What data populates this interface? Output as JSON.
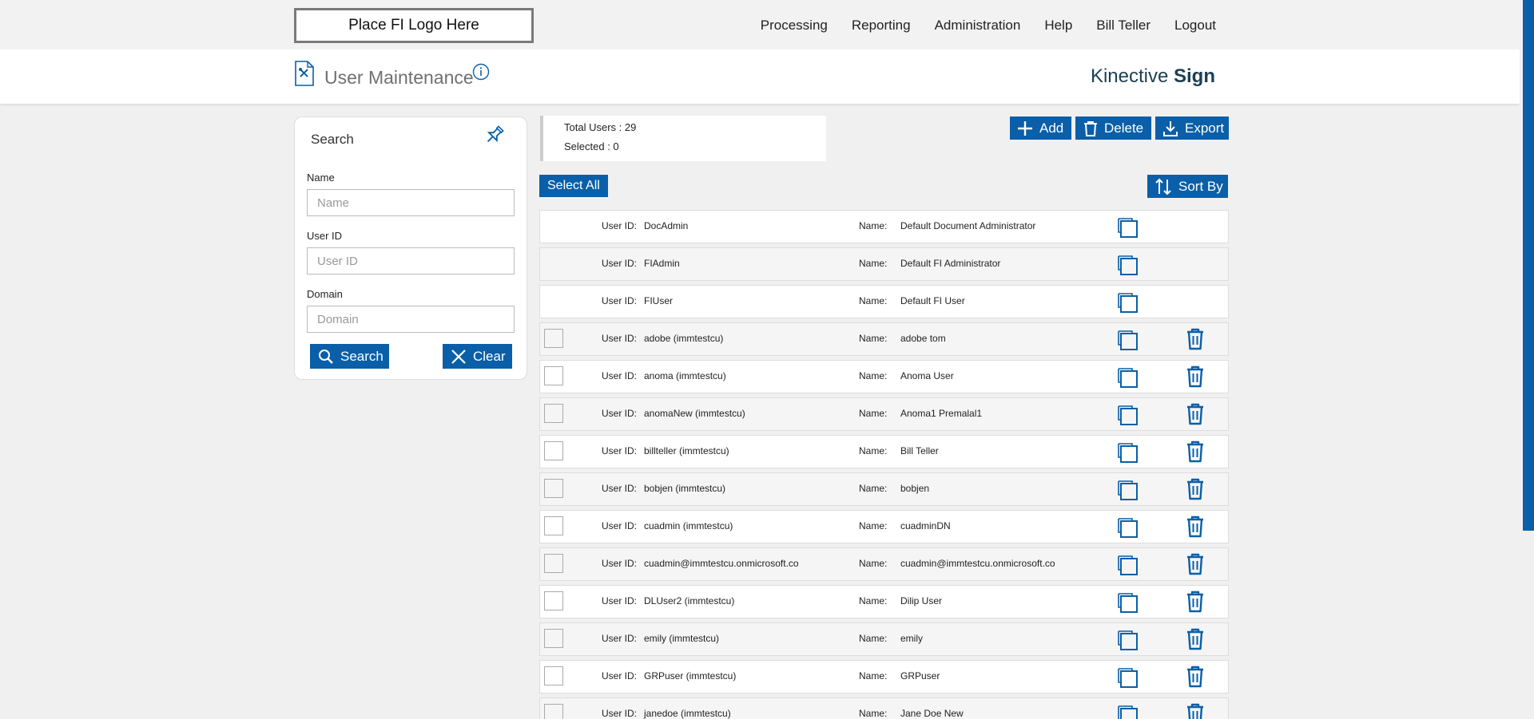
{
  "logo_placeholder": "Place FI Logo Here",
  "nav": {
    "processing": "Processing",
    "reporting": "Reporting",
    "administration": "Administration",
    "help": "Help",
    "user": "Bill Teller",
    "logout": "Logout"
  },
  "header": {
    "title": "User Maintenance",
    "brand_light": "Kinective ",
    "brand_bold": "Sign"
  },
  "search": {
    "title": "Search",
    "name_label": "Name",
    "name_placeholder": "Name",
    "userid_label": "User ID",
    "userid_placeholder": "User ID",
    "domain_label": "Domain",
    "domain_placeholder": "Domain",
    "search_button": "Search",
    "clear_button": "Clear"
  },
  "stats": {
    "total_users": "Total Users : 29",
    "selected": "Selected : 0"
  },
  "actions": {
    "add": "Add",
    "delete": "Delete",
    "export": "Export",
    "select_all": "Select All",
    "sort_by": "Sort By"
  },
  "labels": {
    "user_id": "User ID:",
    "name": "Name:"
  },
  "users": [
    {
      "user_id": "DocAdmin",
      "name": "Default Document Administrator"
    },
    {
      "user_id": "FIAdmin",
      "name": "Default FI Administrator"
    },
    {
      "user_id": "FIUser",
      "name": "Default FI User"
    },
    {
      "user_id": "adobe (immtestcu)",
      "name": "adobe tom"
    },
    {
      "user_id": "anoma (immtestcu)",
      "name": "Anoma User"
    },
    {
      "user_id": "anomaNew (immtestcu)",
      "name": "Anoma1 Premalal1"
    },
    {
      "user_id": "billteller (immtestcu)",
      "name": "Bill Teller"
    },
    {
      "user_id": "bobjen (immtestcu)",
      "name": "bobjen"
    },
    {
      "user_id": "cuadmin (immtestcu)",
      "name": "cuadminDN"
    },
    {
      "user_id": "cuadmin@immtestcu.onmicrosoft.co",
      "name": "cuadmin@immtestcu.onmicrosoft.co"
    },
    {
      "user_id": "DLUser2 (immtestcu)",
      "name": "Dilip User"
    },
    {
      "user_id": "emily (immtestcu)",
      "name": "emily"
    },
    {
      "user_id": "GRPuser (immtestcu)",
      "name": "GRPuser"
    },
    {
      "user_id": "janedoe (immtestcu)",
      "name": "Jane Doe New"
    }
  ],
  "colors": {
    "accent": "#0a5fa8",
    "brand_text": "#1c3f52"
  }
}
